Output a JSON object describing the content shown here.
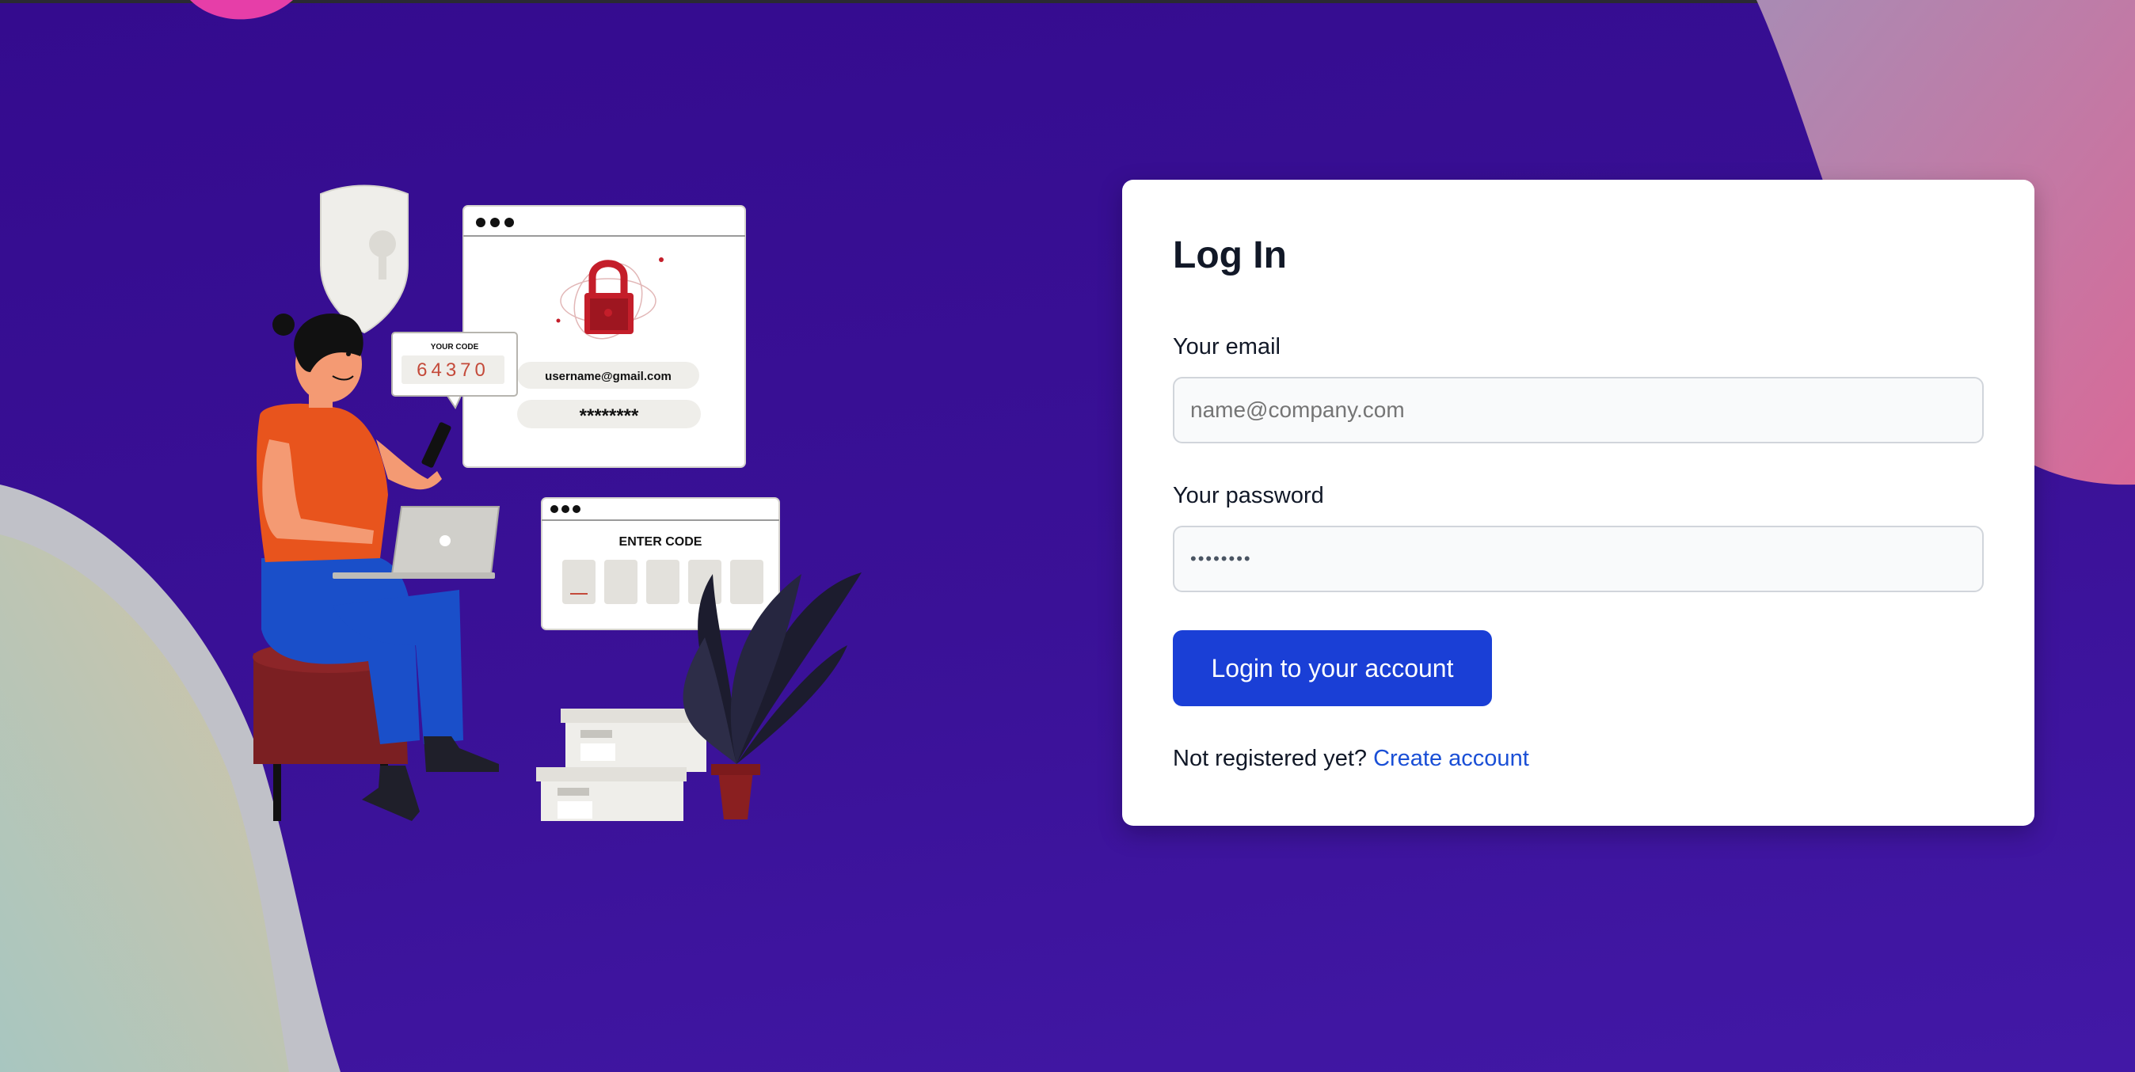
{
  "login": {
    "title": "Log In",
    "email_label": "Your email",
    "email_placeholder": "name@company.com",
    "password_label": "Your password",
    "password_value": "••••••••",
    "submit_label": "Login to your account",
    "register_prompt": "Not registered yet?",
    "register_link": "Create account"
  },
  "illustration": {
    "code_label": "YOUR CODE",
    "code_value": "64370",
    "username": "username@gmail.com",
    "password_mask": "********",
    "enter_code_label": "ENTER CODE"
  },
  "colors": {
    "background": "#340b8e",
    "button": "#1a3fd6",
    "link": "#1a4fd6",
    "shirt": "#e8541d",
    "pants": "#1a4fc9",
    "lock": "#c41e2a"
  }
}
